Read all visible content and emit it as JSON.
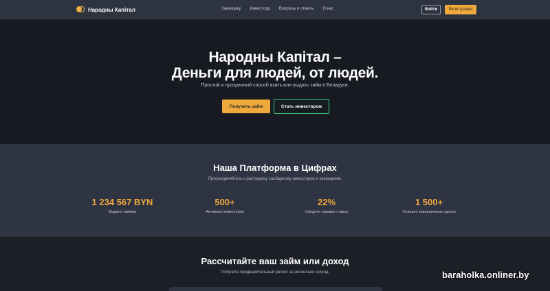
{
  "navbar": {
    "brand": "Народны Капітал",
    "links": [
      "Заемщику",
      "Инвестору",
      "Вопросы и ответы",
      "О нас"
    ],
    "login_label": "Войти",
    "register_label": "Регистрация"
  },
  "hero": {
    "title_line1": "Народны Капітал –",
    "title_line2": "Деньги для людей, от людей.",
    "subtitle": "Простой и прозрачный способ взять или выдать займ в Беларуси.",
    "primary_button": "Получить займ",
    "secondary_button": "Стать инвестором"
  },
  "stats": {
    "title": "Наша Платформа в Цифрах",
    "subtitle": "Присоединяйтесь к растущему сообществу инвесторов и заемщиков.",
    "items": [
      {
        "value": "1 234 567 BYN",
        "label": "Выдано займов"
      },
      {
        "value": "500+",
        "label": "Активных инвесторов"
      },
      {
        "value": "22%",
        "label": "Средняя годовая ставка"
      },
      {
        "value": "1 500+",
        "label": "Успешно завершенных сделок"
      }
    ]
  },
  "calculator": {
    "title": "Рассчитайте ваш займ или доход",
    "subtitle": "Получите предварительный расчет за несколько секунд."
  },
  "watermark": "baraholka.onliner.by",
  "colors": {
    "accent": "#f0a93b",
    "outline_green": "#35d07f",
    "navbar_bg": "#2e3340",
    "hero_bg": "#171a20",
    "stats_bg": "#2f3443"
  },
  "icons": {
    "logo": "coins-logo-icon"
  }
}
